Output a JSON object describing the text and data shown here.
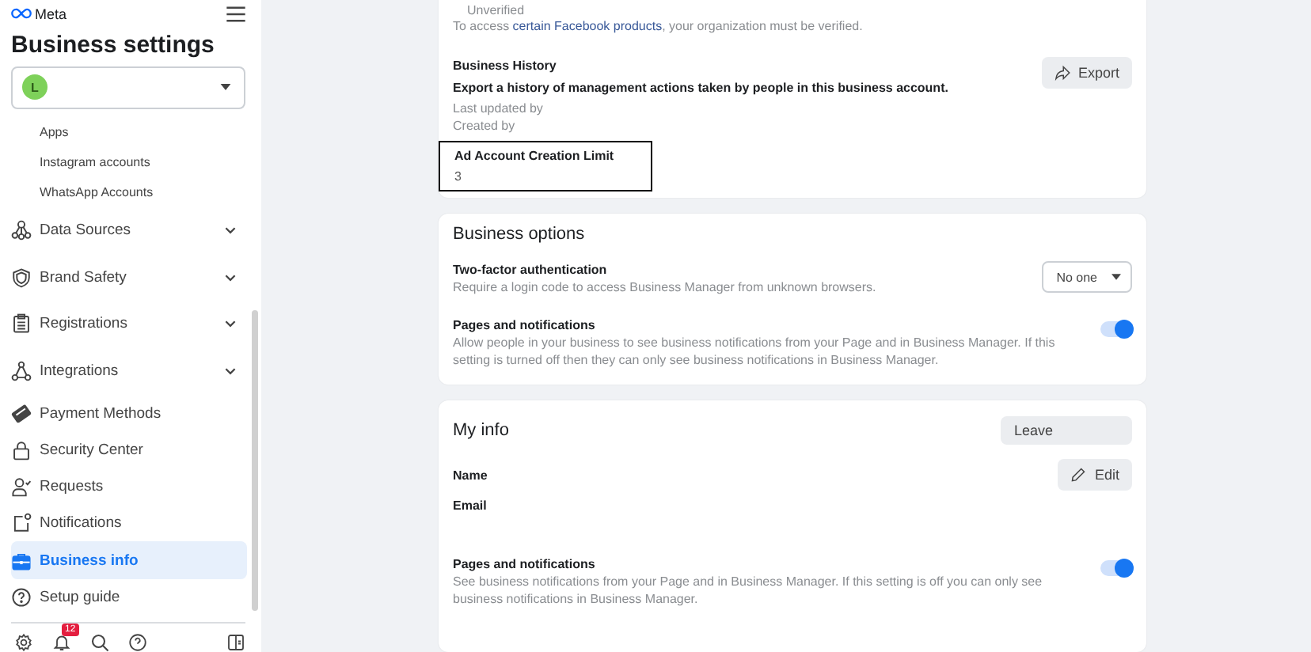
{
  "sidebar": {
    "logo": "Meta",
    "title": "Business settings",
    "account": {
      "initial": "L"
    },
    "sub_items": [
      "Apps",
      "Instagram accounts",
      "WhatsApp Accounts"
    ],
    "items": [
      {
        "label": "Data Sources",
        "kind": "nodes",
        "expandable": true,
        "selected": false
      },
      {
        "label": "Brand Safety",
        "kind": "shield",
        "expandable": true,
        "selected": false
      },
      {
        "label": "Registrations",
        "kind": "clipboard",
        "expandable": true,
        "selected": false
      },
      {
        "label": "Integrations",
        "kind": "triangle",
        "expandable": true,
        "selected": false
      },
      {
        "label": "Payment Methods",
        "kind": "card",
        "expandable": false,
        "selected": false
      },
      {
        "label": "Security Center",
        "kind": "lock",
        "expandable": false,
        "selected": false
      },
      {
        "label": "Requests",
        "kind": "person",
        "expandable": false,
        "selected": false
      },
      {
        "label": "Notifications",
        "kind": "notify",
        "expandable": false,
        "selected": false
      },
      {
        "label": "Business info",
        "kind": "briefcase",
        "expandable": false,
        "selected": true
      },
      {
        "label": "Setup guide",
        "kind": "help",
        "expandable": false,
        "selected": false
      }
    ],
    "footer": {
      "notification_badge": "12"
    }
  },
  "verification": {
    "status": "Unverified",
    "note_before": "To access ",
    "note_link": "certain Facebook products",
    "note_after": ", your organization must be verified."
  },
  "business_history": {
    "title": "Business History",
    "description": "Export a history of management actions taken by people in this business account.",
    "lines": [
      "Last updated by",
      "Created by"
    ],
    "button": "Export"
  },
  "ad_account_limit": {
    "label": "Ad Account Creation Limit",
    "value": "3",
    "highlighted": true
  },
  "business_options": {
    "title": "Business options",
    "two_factor": {
      "title": "Two-factor authentication",
      "description": "Require a login code to access Business Manager from unknown browsers.",
      "value": "No one"
    },
    "pages_notifications": {
      "title": "Pages and notifications",
      "description": "Allow people in your business to see business notifications from your Page and in Business Manager. If this setting is turned off then they can only see business notifications in Business Manager.",
      "on": true
    }
  },
  "my_info": {
    "title": "My info",
    "button": "Leave",
    "name_label": "Name",
    "edit_button": "Edit",
    "email_label": "Email",
    "pages_notifications": {
      "title": "Pages and notifications",
      "description": "See business notifications from your Page and in Business Manager. If this setting is off you can only see business notifications in Business Manager.",
      "on": true
    }
  }
}
